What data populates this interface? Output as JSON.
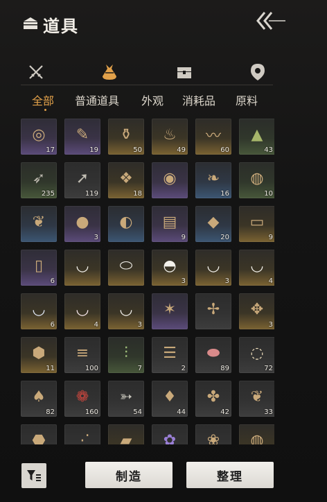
{
  "header": {
    "title": "道具",
    "title_icon": "chest-icon",
    "back_icon": "double-chevron-back-icon"
  },
  "tabs": [
    {
      "icon": "crossed-swords-icon",
      "active": false
    },
    {
      "icon": "item-pouch-icon",
      "active": true
    },
    {
      "icon": "treasure-chest-icon",
      "active": false
    },
    {
      "icon": "location-pin-icon",
      "active": false
    }
  ],
  "subtabs": [
    "全部",
    "普通道具",
    "外观",
    "消耗品",
    "原料"
  ],
  "active_subtab": "全部",
  "colors": {
    "accent": "#e2a14a"
  },
  "items": [
    {
      "icon": "jade-token",
      "qty": "17",
      "quality": "purple"
    },
    {
      "icon": "scroll-tag",
      "qty": "19",
      "quality": "purple"
    },
    {
      "icon": "incense-burner",
      "qty": "50",
      "quality": "gold"
    },
    {
      "icon": "cloth-sack",
      "qty": "49",
      "quality": "gold"
    },
    {
      "icon": "talisman-paper",
      "qty": "60",
      "quality": "gold"
    },
    {
      "icon": "herb-powder",
      "qty": "43",
      "quality": "green"
    },
    {
      "icon": "arrows",
      "qty": "235",
      "quality": "green"
    },
    {
      "icon": "spear-arrows",
      "qty": "119",
      "quality": "grey"
    },
    {
      "icon": "crystal-shards",
      "qty": "18",
      "quality": "gold"
    },
    {
      "icon": "stew-bowl",
      "qty": "",
      "quality": "purple"
    },
    {
      "icon": "roasted-meat",
      "qty": "16",
      "quality": "blue"
    },
    {
      "icon": "clay-pot-dish",
      "qty": "10",
      "quality": "green"
    },
    {
      "icon": "meat-skewer",
      "qty": "",
      "quality": "blue"
    },
    {
      "icon": "braised-dish",
      "qty": "3",
      "quality": "purple"
    },
    {
      "icon": "roasted-chicken",
      "qty": "",
      "quality": "blue"
    },
    {
      "icon": "layered-cake",
      "qty": "9",
      "quality": "purple"
    },
    {
      "icon": "golden-pastry",
      "qty": "20",
      "quality": "blue"
    },
    {
      "icon": "recipe-paper",
      "qty": "9",
      "quality": "gold"
    },
    {
      "icon": "recipe-scroll",
      "qty": "6",
      "quality": "purple"
    },
    {
      "icon": "white-bowl",
      "qty": "",
      "quality": "gold"
    },
    {
      "icon": "shallow-plate",
      "qty": "",
      "quality": "gold"
    },
    {
      "icon": "covered-cup",
      "qty": "3",
      "quality": "gold"
    },
    {
      "icon": "porcelain-bowl",
      "qty": "3",
      "quality": "gold"
    },
    {
      "icon": "painted-bowl",
      "qty": "4",
      "quality": "gold"
    },
    {
      "icon": "blue-white-bowl",
      "qty": "6",
      "quality": "gold"
    },
    {
      "icon": "flower-bowl",
      "qty": "4",
      "quality": "gold"
    },
    {
      "icon": "plain-bowl",
      "qty": "3",
      "quality": "gold"
    },
    {
      "icon": "moth",
      "qty": "",
      "quality": "purple"
    },
    {
      "icon": "dragonfly",
      "qty": "",
      "quality": "grey"
    },
    {
      "icon": "cricket",
      "qty": "3",
      "quality": "gold"
    },
    {
      "icon": "ore-rock",
      "qty": "11",
      "quality": "gold"
    },
    {
      "icon": "wood-logs",
      "qty": "100",
      "quality": "grey"
    },
    {
      "icon": "bamboo",
      "qty": "7",
      "quality": "green"
    },
    {
      "icon": "timber",
      "qty": "2",
      "quality": "grey"
    },
    {
      "icon": "raw-meat",
      "qty": "89",
      "quality": "grey"
    },
    {
      "icon": "eggs",
      "qty": "72",
      "quality": "grey"
    },
    {
      "icon": "mushrooms",
      "qty": "82",
      "quality": "grey"
    },
    {
      "icon": "berries",
      "qty": "160",
      "quality": "grey"
    },
    {
      "icon": "fish",
      "qty": "54",
      "quality": "grey"
    },
    {
      "icon": "grain-sack",
      "qty": "44",
      "quality": "grey"
    },
    {
      "icon": "beetle",
      "qty": "42",
      "quality": "grey"
    },
    {
      "icon": "feather",
      "qty": "33",
      "quality": "grey"
    },
    {
      "icon": "stone",
      "qty": "",
      "quality": "grey"
    },
    {
      "icon": "branches",
      "qty": "",
      "quality": "grey"
    },
    {
      "icon": "bark",
      "qty": "",
      "quality": "gold"
    },
    {
      "icon": "lavender",
      "qty": "",
      "quality": "grey"
    },
    {
      "icon": "flower-berries",
      "qty": "",
      "quality": "grey"
    },
    {
      "icon": "herb-bowl",
      "qty": "",
      "quality": "gold"
    }
  ],
  "bottom": {
    "filter_icon": "filter-list-icon",
    "craft_label": "制造",
    "sort_label": "整理"
  }
}
